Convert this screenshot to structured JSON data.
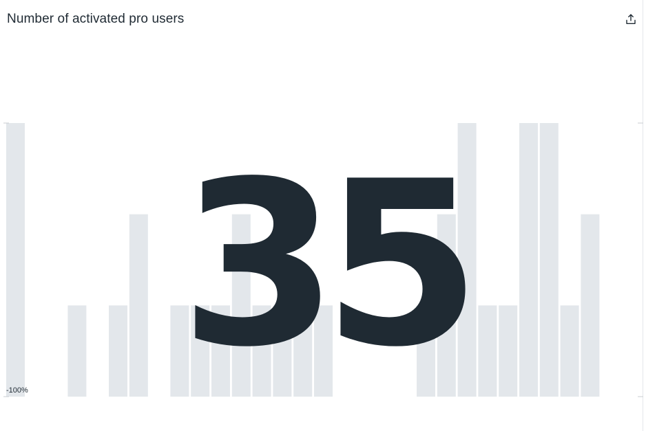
{
  "widget": {
    "title": "Number of activated pro users",
    "value": "35",
    "change_label": "-100%",
    "export_icon": "share-upload-icon"
  },
  "colors": {
    "bar": "#e3e7eb",
    "text": "#1f2a33",
    "axis": "#c8cdd2"
  },
  "chart_data": {
    "type": "bar",
    "ylim": [
      0,
      3
    ],
    "grid": false,
    "values": [
      3,
      0,
      0,
      1,
      0,
      1,
      2,
      0,
      1,
      1,
      1,
      2,
      1,
      1,
      1,
      1,
      0,
      0,
      0,
      0,
      1,
      2,
      3,
      1,
      1,
      3,
      3,
      1,
      2
    ]
  }
}
